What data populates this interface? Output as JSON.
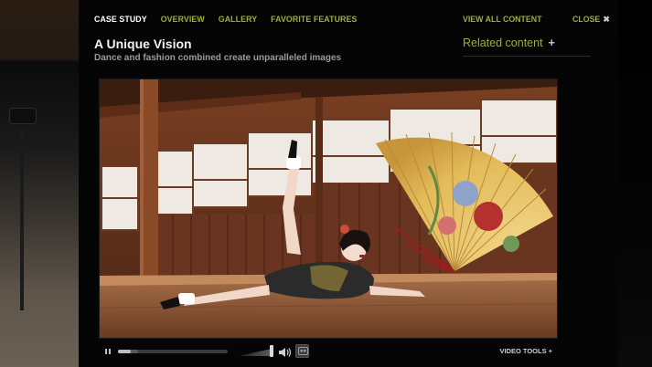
{
  "nav": {
    "tabs": [
      {
        "label": "CASE STUDY",
        "active": true
      },
      {
        "label": "OVERVIEW",
        "active": false
      },
      {
        "label": "GALLERY",
        "active": false
      },
      {
        "label": "FAVORITE FEATURES",
        "active": false
      }
    ],
    "view_all_label": "VIEW ALL CONTENT",
    "close_label": "CLOSE",
    "close_icon": "close-icon"
  },
  "header": {
    "title": "A Unique Vision",
    "subtitle": "Dance and fashion combined create unparalleled images"
  },
  "related": {
    "label": "Related content",
    "plus": "+"
  },
  "video": {
    "poster": "dancer-in-kimono-with-fan-image",
    "progress": 0.12,
    "buffered": 0.18,
    "volume": 1.0
  },
  "controls": {
    "pause_icon": "pause-icon",
    "speaker_icon": "speaker-icon",
    "cc_icon": "captions-icon",
    "tools_label": "VIDEO TOOLS",
    "tools_plus": "+"
  },
  "colors": {
    "accent": "#9bb03c",
    "background": "#050505",
    "text": "#ffffff"
  }
}
